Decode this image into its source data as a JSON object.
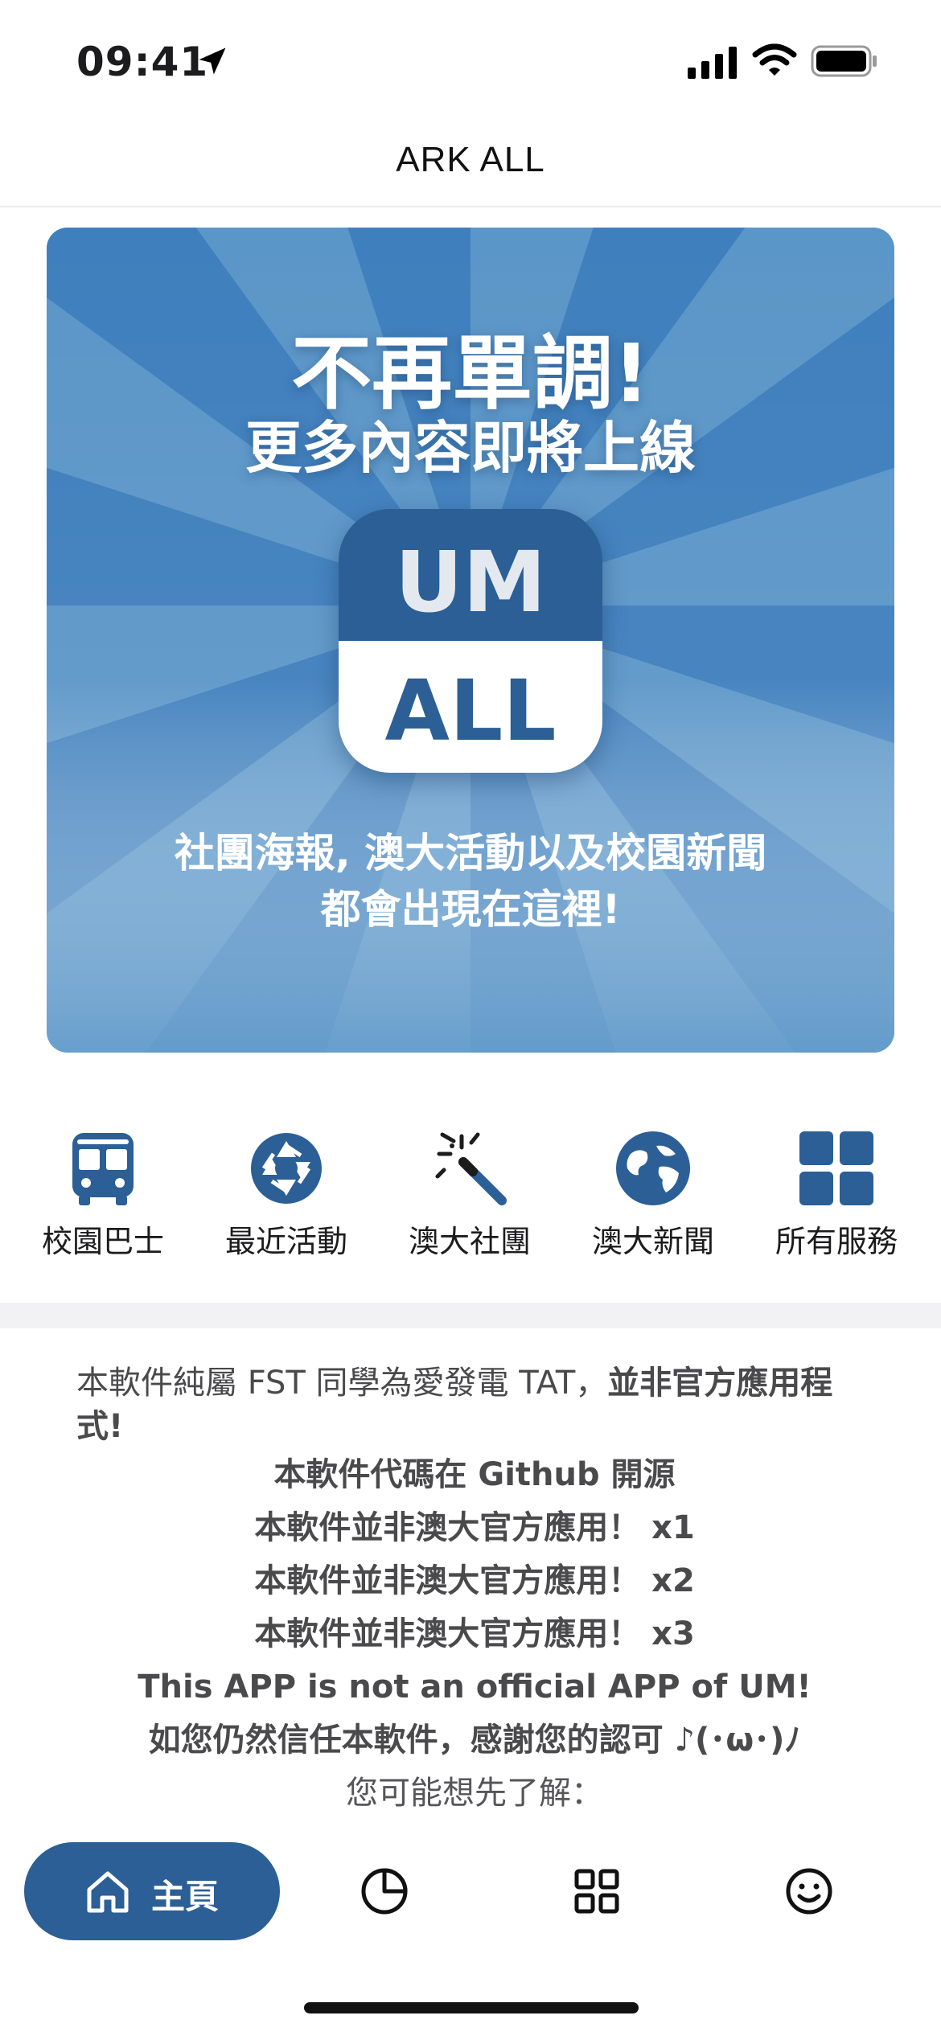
{
  "status_bar": {
    "time": "09:41",
    "icons": [
      "location-arrow-icon",
      "signal-icon",
      "wifi-icon",
      "battery-icon"
    ]
  },
  "nav": {
    "title": "ARK ALL"
  },
  "banner": {
    "title": "不再單調!",
    "subtitle": "更多內容即將上線",
    "logo_top": "UM",
    "logo_bottom": "ALL",
    "caption_line1": "社團海報, 澳大活動以及校園新聞",
    "caption_line2": "都會出現在這裡!",
    "colors": {
      "background": "#5b96c8",
      "ray": "#3f7fbd",
      "logo": "#2b5f96"
    }
  },
  "services": [
    {
      "label": "校園巴士",
      "icon": "bus-icon"
    },
    {
      "label": "最近活動",
      "icon": "aperture-icon"
    },
    {
      "label": "澳大社團",
      "icon": "magic-wand-icon"
    },
    {
      "label": "澳大新聞",
      "icon": "globe-icon"
    },
    {
      "label": "所有服務",
      "icon": "grid-icon"
    }
  ],
  "notice": {
    "first_line_normal": "本軟件純屬 FST 同學為愛發電 TAT，",
    "first_line_bold": "並非官方應用程式!",
    "lines": [
      "本軟件代碼在 Github 開源",
      "本軟件並非澳大官方應用！ x1",
      "本軟件並非澳大官方應用！ x2",
      "本軟件並非澳大官方應用！ x3",
      "This APP is not an official APP of UM!",
      "如您仍然信任本軟件，感謝您的認可 ♪(･ω･)ﾉ"
    ],
    "last_line": "您可能想先了解："
  },
  "tab_bar": {
    "home_label": "主頁",
    "icons": [
      "home-icon",
      "pie-chart-icon",
      "apps-grid-icon",
      "smiley-icon"
    ],
    "accent": "#2b5f96"
  }
}
